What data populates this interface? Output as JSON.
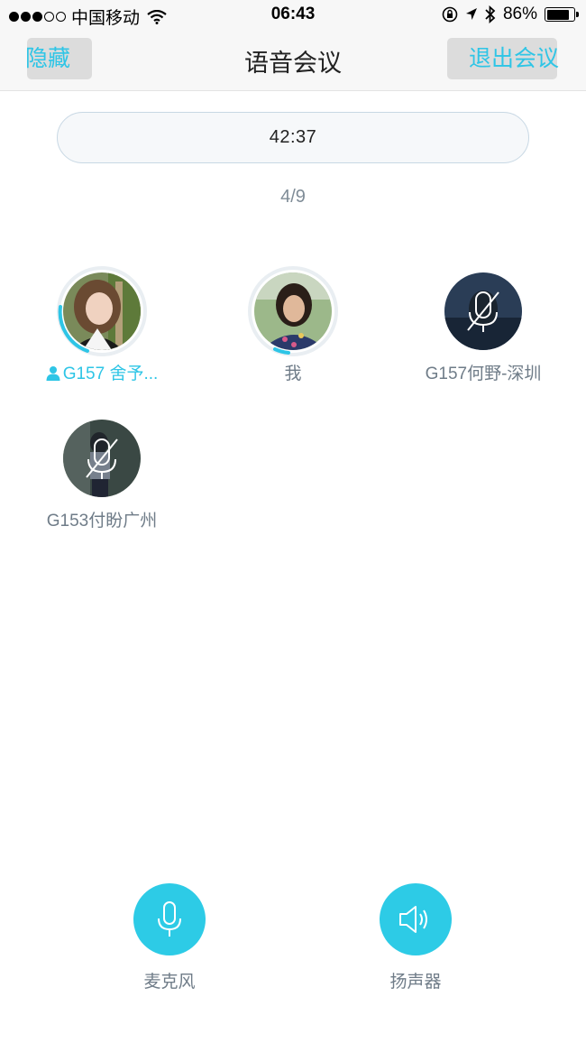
{
  "status_bar": {
    "carrier": "中国移动",
    "time": "06:43",
    "battery_text": "86%",
    "battery_level": 0.86
  },
  "nav": {
    "hide_label": "隐藏",
    "title": "语音会议",
    "exit_label": "退出会议"
  },
  "timer": "42:37",
  "participant_count": "4/9",
  "participants": [
    {
      "name": "G157 舍予...",
      "active": true
    },
    {
      "name": "我",
      "active": false
    },
    {
      "name": "G157何野-深圳",
      "muted": true
    },
    {
      "name": "G153付盼广州",
      "muted": true
    }
  ],
  "controls": {
    "mic_label": "麦克风",
    "speaker_label": "扬声器"
  },
  "colors": {
    "accent": "#2ec5e6",
    "muted_text": "#6f7c88"
  }
}
